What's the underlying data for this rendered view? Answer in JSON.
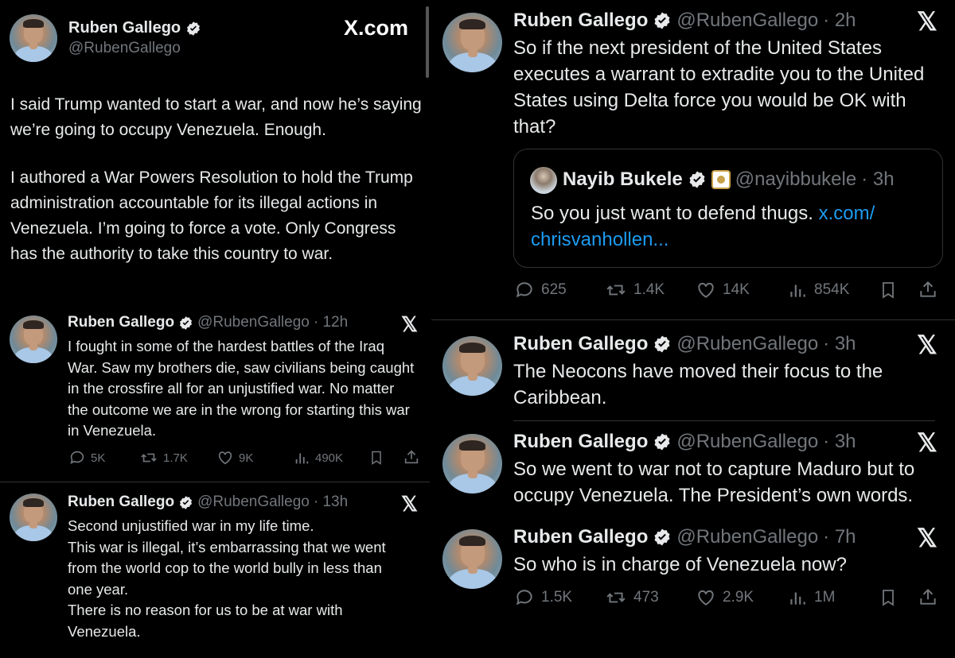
{
  "xcom_label": "X.com",
  "x_mark": "𝕏",
  "verified_color": "#1d9bf0",
  "link_color": "#1d9bf0",
  "main_post": {
    "name": "Ruben Gallego",
    "handle": "@RubenGallego",
    "para1": "I said Trump wanted to start a war, and now he’s saying we’re going to occupy Venezuela. Enough.",
    "para2": "I authored a War Powers Resolution to hold the Trump administration accountable for its illegal actions in Venezuela. I’m going to force a vote. Only Congress has the authority to take this country to war."
  },
  "post_12h": {
    "name": "Ruben Gallego",
    "handle": "@RubenGallego",
    "time": "· 12h",
    "text": "I fought in some of the hardest battles of the Iraq War. Saw my brothers die, saw civilians being caught in the crossfire all for an unjustified war.  No matter the outcome we are in the wrong for starting this war in Venezuela.",
    "replies": "5K",
    "reposts": "1.7K",
    "likes": "9K",
    "views": "490K"
  },
  "post_13h": {
    "name": "Ruben Gallego",
    "handle": "@RubenGallego",
    "time": "· 13h",
    "line1": "Second unjustified war in my life time.",
    "line2": "This war is illegal, it’s embarrassing that we went from the world cop to the world bully in less than one year.",
    "line3": "There is no reason for us to be at war with Venezuela."
  },
  "post_2h": {
    "name": "Ruben Gallego",
    "handle": "@RubenGallego",
    "time": "· 2h",
    "text": "So if the next president of the United States executes a warrant to extradite you to the United States using Delta force you would be OK with that?",
    "quote": {
      "name": "Nayib Bukele",
      "handle": "@nayibbukele",
      "time": "· 3h",
      "text": "So you just want to defend thugs.",
      "link": "x.com/ chrisvanhollen..."
    },
    "replies": "625",
    "reposts": "1.4K",
    "likes": "14K",
    "views": "854K"
  },
  "post_3h_a": {
    "name": "Ruben Gallego",
    "handle": "@RubenGallego",
    "time": "· 3h",
    "text": "The Neocons have moved their focus to the Caribbean."
  },
  "post_3h_b": {
    "name": "Ruben Gallego",
    "handle": "@RubenGallego",
    "time": "· 3h",
    "text": "So we went to war not to capture Maduro but to occupy Venezuela.  The President’s own words."
  },
  "post_7h": {
    "name": "Ruben Gallego",
    "handle": "@RubenGallego",
    "time": "· 7h",
    "text": "So who is in charge of Venezuela now?",
    "replies": "1.5K",
    "reposts": "473",
    "likes": "2.9K",
    "views": "1M"
  }
}
